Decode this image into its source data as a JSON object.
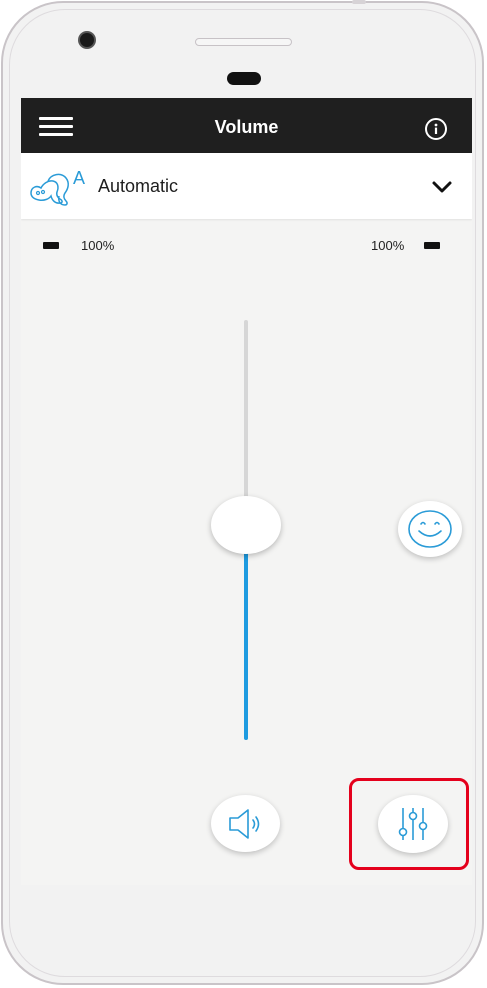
{
  "header": {
    "title": "Volume",
    "menu_icon": "hamburger-menu-icon",
    "info_icon": "info-icon"
  },
  "program": {
    "label": "Automatic",
    "icon": "hearing-aid-automatic-icon",
    "icon_letter": "A",
    "dropdown_icon": "chevron-down-icon"
  },
  "battery": {
    "left": "100%",
    "right": "100%"
  },
  "volume": {
    "level": 0.45
  },
  "buttons": {
    "smiley_icon": "smiley-icon",
    "speaker_icon": "speaker-icon",
    "equalizer_icon": "equalizer-icon"
  },
  "colors": {
    "accent": "#1e9be0",
    "header_bg": "#1f1f1f",
    "highlight": "#e4001c"
  }
}
